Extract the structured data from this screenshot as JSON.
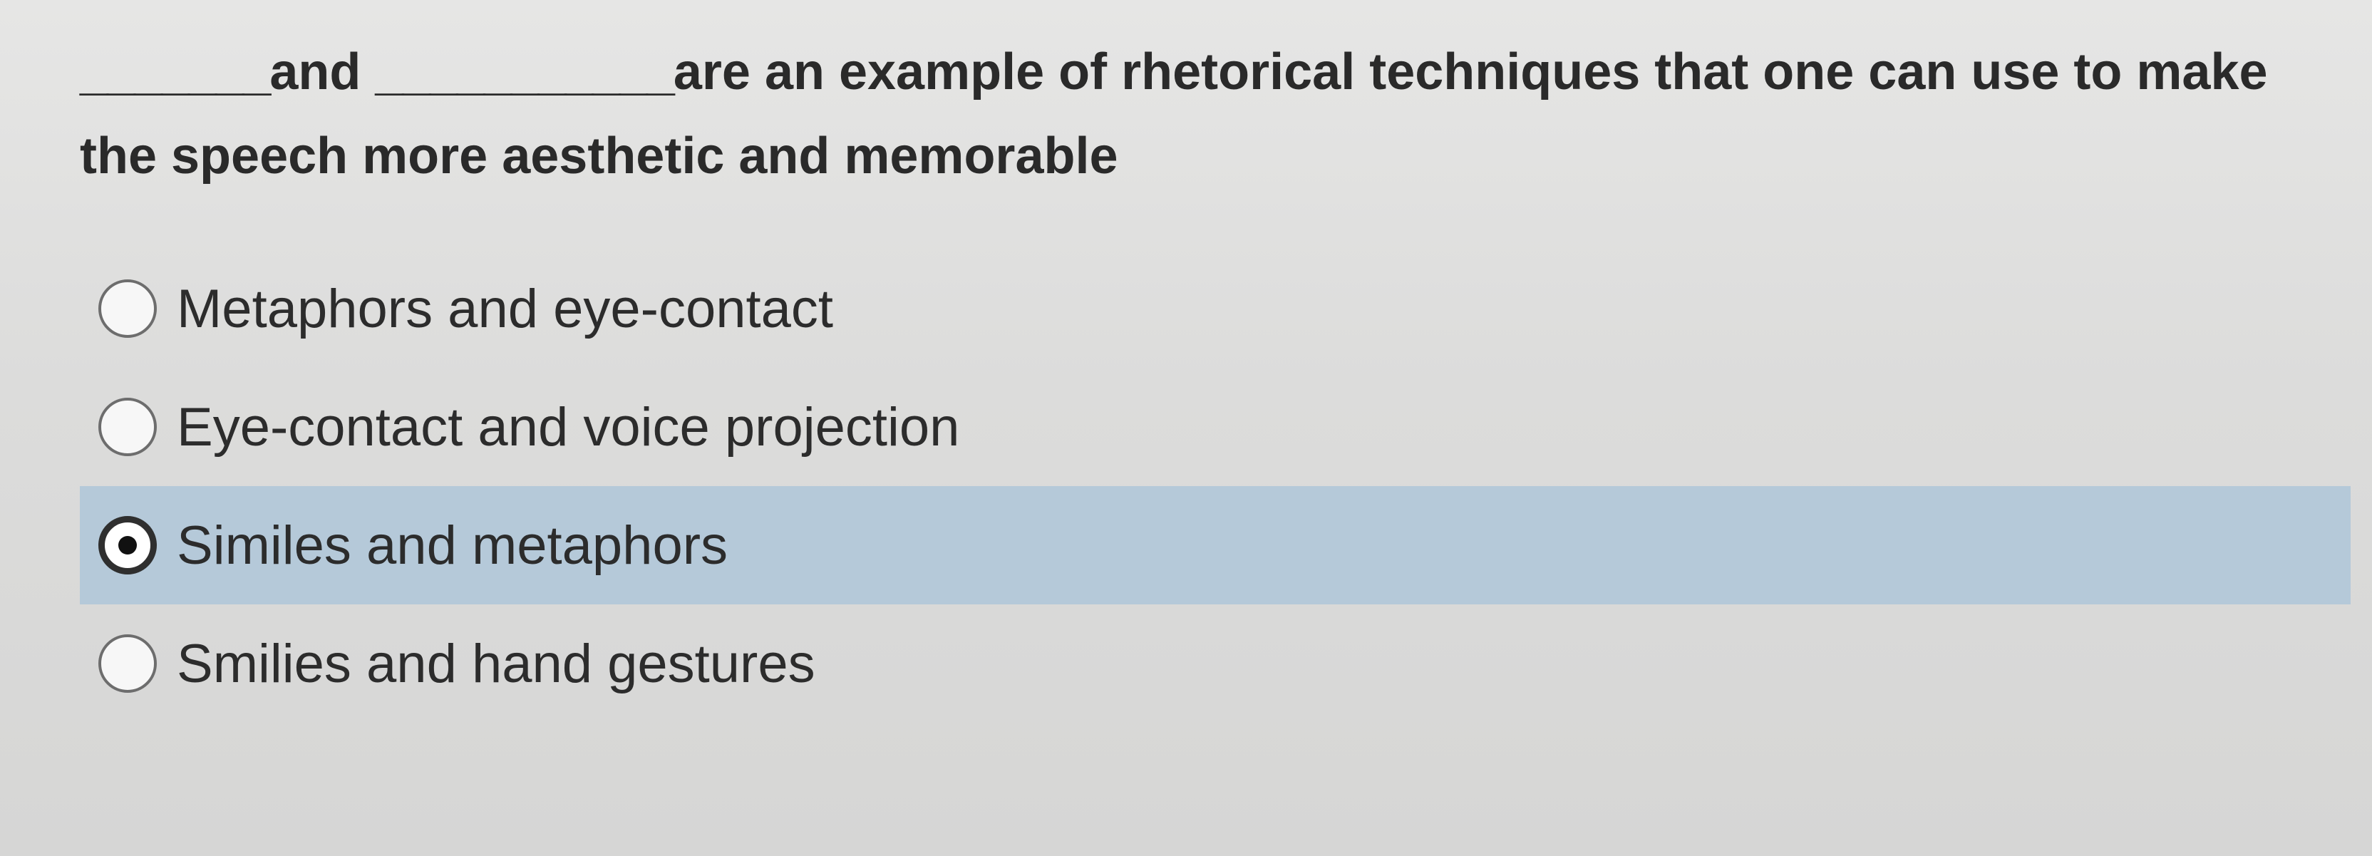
{
  "question": {
    "blank1": "_______",
    "word_and": "and",
    "blank2": "___________",
    "rest": "are an example of rhetorical techniques that one can use to make the speech more aesthetic and memorable"
  },
  "options": [
    {
      "label": "Metaphors and eye-contact",
      "selected": false
    },
    {
      "label": "Eye-contact and voice projection",
      "selected": false
    },
    {
      "label": "Similes and metaphors",
      "selected": true
    },
    {
      "label": "Smilies and hand gestures",
      "selected": false
    }
  ],
  "colors": {
    "selected_highlight": "#b5c9d9",
    "background": "#dcdcdb",
    "text": "#2b2b2b"
  }
}
